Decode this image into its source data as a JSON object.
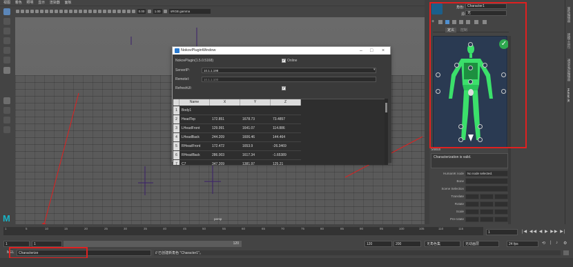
{
  "menu": [
    "视图",
    "着色",
    "照明",
    "显示",
    "渲染器",
    "面板"
  ],
  "toolbar": {
    "value1": "0.00",
    "value2": "1.00",
    "colorspace": "sRGB gamma"
  },
  "viewport": {
    "camera_label": "persp"
  },
  "plugin_window": {
    "title": "NokovPluginWindow",
    "version_label": "NokovPlugin(1.5.0.5168)",
    "online_label": "Online",
    "online_checked": "✓",
    "server_label": "ServerIP:",
    "server_value": "10.1.1.198",
    "remote_label": "RemoteI:",
    "remote_value": "10.1.1.100",
    "refresh_label": "RefreshUI:",
    "refresh_checked": "✓",
    "columns": [
      "Name",
      "X",
      "Y",
      "Z"
    ],
    "rows": [
      {
        "n": "1",
        "name": "Body1",
        "x": "",
        "y": "",
        "z": ""
      },
      {
        "n": "2",
        "name": "HeadTop",
        "x": "172.851",
        "y": "1678.73",
        "z": "73.4857"
      },
      {
        "n": "3",
        "name": "LHeadFront",
        "x": "129.991",
        "y": "1641.07",
        "z": "114.886"
      },
      {
        "n": "4",
        "name": "LHeadBack",
        "x": "244.209",
        "y": "1606.46",
        "z": "144.464"
      },
      {
        "n": "5",
        "name": "RHeadFront",
        "x": "172.472",
        "y": "1653.9",
        "z": "-26.3469"
      },
      {
        "n": "6",
        "name": "RHeadBack",
        "x": "286.003",
        "y": "1617.34",
        "z": "-1.65389"
      },
      {
        "n": "7",
        "name": "C7",
        "x": "347.209",
        "y": "1381.97",
        "z": "125.21"
      }
    ]
  },
  "hik": {
    "character_label": "角色:",
    "character_value": "Character1",
    "source_label": "源:",
    "source_value": "无",
    "tabs": [
      "定义",
      "控制"
    ],
    "status_title": "Status",
    "status_text": "Characterization is valid.",
    "props": [
      {
        "label": "HumanIK node",
        "value": "No node selected."
      },
      {
        "label": "Bone",
        "value": ""
      },
      {
        "label": "Scene Selection",
        "value": ""
      },
      {
        "label": "Translate",
        "value": ""
      },
      {
        "label": "Rotate",
        "value": ""
      },
      {
        "label": "Scale",
        "value": ""
      },
      {
        "label": "Pre-rotate",
        "value": ""
      }
    ]
  },
  "side_tabs": [
    "属性编辑器",
    "建模工具包",
    "通道盒/层编辑器",
    "Human IK"
  ],
  "timeline": {
    "ticks": [
      "1",
      "5",
      "10",
      "15",
      "20",
      "25",
      "30",
      "35",
      "40",
      "45",
      "50",
      "55",
      "60",
      "65",
      "70",
      "75",
      "80",
      "85",
      "90",
      "95",
      "100",
      "105",
      "110",
      "115"
    ],
    "current_frame": "1"
  },
  "range": {
    "start": "1",
    "inner_start": "1",
    "inner_end": "120",
    "end": "120",
    "anim_end": "200",
    "char_set": "无角色集",
    "anim_layer": "无动画层",
    "fps": "24 fps"
  },
  "cmd": {
    "lang": "MEL",
    "input": "Characterize",
    "result": "// 已创建新角色 \"Character1\"。"
  }
}
